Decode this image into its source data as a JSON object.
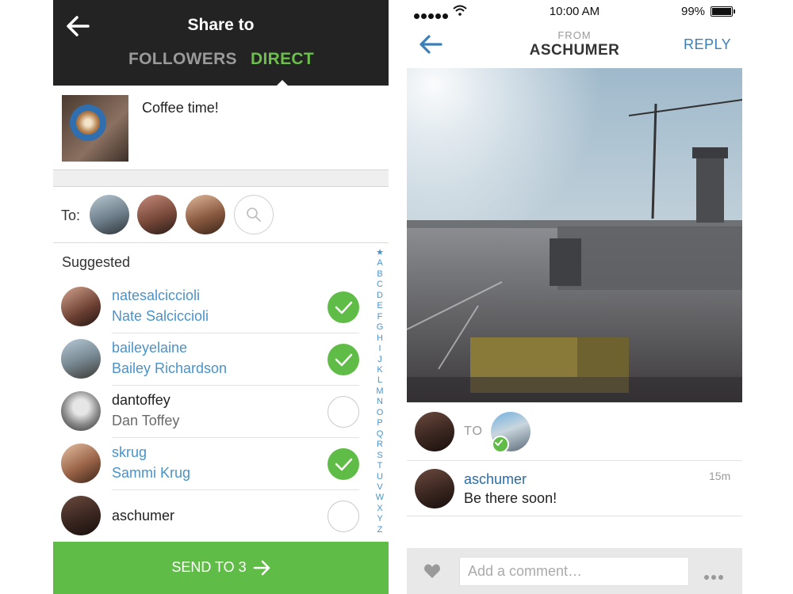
{
  "colors": {
    "accent_green": "#5fbc46",
    "accent_blue": "#4a93c9",
    "header_dark": "#232323"
  },
  "left": {
    "title": "Share to",
    "tabs": [
      {
        "label": "FOLLOWERS",
        "active": false
      },
      {
        "label": "DIRECT",
        "active": true
      }
    ],
    "post": {
      "caption": "Coffee time!",
      "thumbnail_icon": "latte-photo"
    },
    "to_label": "To:",
    "search_icon": "search-icon",
    "suggested_label": "Suggested",
    "suggestions": [
      {
        "username": "natesalciccioli",
        "full_name": "Nate Salciccioli",
        "selected": true
      },
      {
        "username": "baileyelaine",
        "full_name": "Bailey Richardson",
        "selected": true
      },
      {
        "username": "dantoffey",
        "full_name": "Dan Toffey",
        "selected": false
      },
      {
        "username": "skrug",
        "full_name": "Sammi Krug",
        "selected": true
      },
      {
        "username": "aschumer",
        "full_name": "",
        "selected": false
      }
    ],
    "alphabet": [
      "★",
      "A",
      "B",
      "C",
      "D",
      "E",
      "F",
      "G",
      "H",
      "I",
      "J",
      "K",
      "L",
      "M",
      "N",
      "O",
      "P",
      "Q",
      "R",
      "S",
      "T",
      "U",
      "V",
      "W",
      "X",
      "Y",
      "Z"
    ],
    "send_label": "SEND TO 3"
  },
  "right": {
    "status": {
      "time": "10:00 AM",
      "battery": "99%"
    },
    "from_label": "FROM",
    "from_user": "ASCHUMER",
    "reply_label": "REPLY",
    "to_label": "TO",
    "comment": {
      "username": "aschumer",
      "text": "Be there soon!",
      "time": "15m"
    },
    "comment_placeholder": "Add a comment…"
  }
}
